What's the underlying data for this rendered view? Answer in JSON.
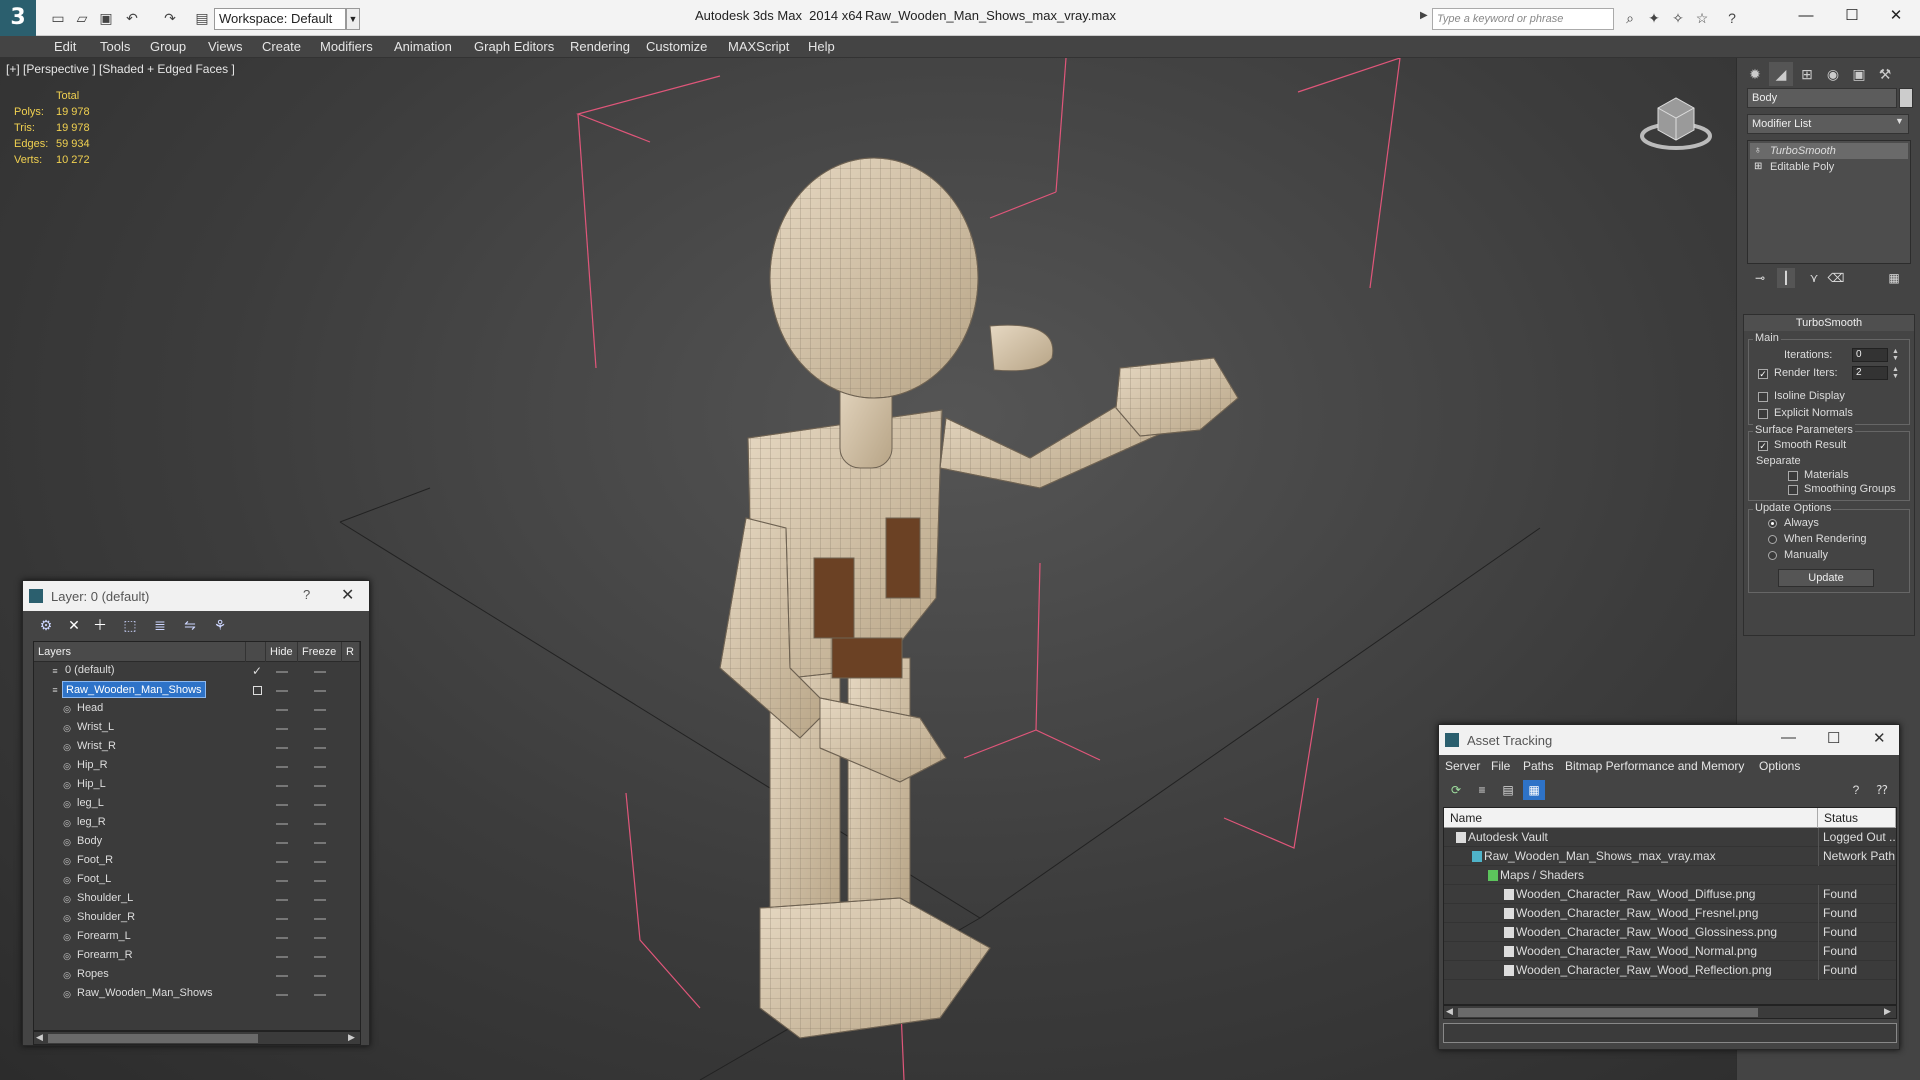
{
  "titlebar": {
    "workspace": "Workspace: Default",
    "app_title": "Autodesk 3ds Max  2014 x64",
    "file_title": "Raw_Wooden_Man_Shows_max_vray.max",
    "search_placeholder": "Type a keyword or phrase"
  },
  "menubar": [
    "Edit",
    "Tools",
    "Group",
    "Views",
    "Create",
    "Modifiers",
    "Animation",
    "Graph Editors",
    "Rendering",
    "Customize",
    "MAXScript",
    "Help"
  ],
  "viewport": {
    "label": "[+] [Perspective ] [Shaded + Edged Faces ]",
    "stats_header": "Total",
    "stats": [
      {
        "label": "Polys:",
        "value": "19 978"
      },
      {
        "label": "Tris:",
        "value": "19 978"
      },
      {
        "label": "Edges:",
        "value": "59 934"
      },
      {
        "label": "Verts:",
        "value": "10 272"
      }
    ]
  },
  "command_panel": {
    "object_name": "Body",
    "modifier_list": "Modifier List",
    "stack": [
      "TurboSmooth",
      "Editable Poly"
    ],
    "rollout_title": "TurboSmooth",
    "main_group": "Main",
    "iterations_label": "Iterations:",
    "iterations_value": "0",
    "render_iters_label": "Render Iters:",
    "render_iters_value": "2",
    "isoline_label": "Isoline Display",
    "explicit_normals_label": "Explicit Normals",
    "surface_group": "Surface Parameters",
    "smooth_result_label": "Smooth Result",
    "separate_label": "Separate",
    "materials_label": "Materials",
    "smoothing_groups_label": "Smoothing Groups",
    "update_group": "Update Options",
    "always_label": "Always",
    "when_rendering_label": "When Rendering",
    "manually_label": "Manually",
    "update_button": "Update"
  },
  "layer_dialog": {
    "title": "Layer: 0 (default)",
    "help": "?",
    "columns": {
      "layers": "Layers",
      "hide": "Hide",
      "freeze": "Freeze",
      "render": "R"
    },
    "rows": [
      {
        "name": "0 (default)",
        "indent": 1
      },
      {
        "name": "Raw_Wooden_Man_Shows",
        "indent": 1
      },
      {
        "name": "Head",
        "indent": 2
      },
      {
        "name": "Wrist_L",
        "indent": 2
      },
      {
        "name": "Wrist_R",
        "indent": 2
      },
      {
        "name": "Hip_R",
        "indent": 2
      },
      {
        "name": "Hip_L",
        "indent": 2
      },
      {
        "name": "leg_L",
        "indent": 2
      },
      {
        "name": "leg_R",
        "indent": 2
      },
      {
        "name": "Body",
        "indent": 2
      },
      {
        "name": "Foot_R",
        "indent": 2
      },
      {
        "name": "Foot_L",
        "indent": 2
      },
      {
        "name": "Shoulder_L",
        "indent": 2
      },
      {
        "name": "Shoulder_R",
        "indent": 2
      },
      {
        "name": "Forearm_L",
        "indent": 2
      },
      {
        "name": "Forearm_R",
        "indent": 2
      },
      {
        "name": "Ropes",
        "indent": 2
      },
      {
        "name": "Raw_Wooden_Man_Shows",
        "indent": 2
      }
    ]
  },
  "asset_dialog": {
    "title": "Asset Tracking",
    "menu": [
      "Server",
      "File",
      "Paths",
      "Bitmap Performance and Memory",
      "Options"
    ],
    "columns": {
      "name": "Name",
      "status": "Status"
    },
    "rows": [
      {
        "name": "Autodesk Vault",
        "status": "Logged Out ..."
      },
      {
        "name": "Raw_Wooden_Man_Shows_max_vray.max",
        "status": "Network Path"
      },
      {
        "name": "Maps / Shaders",
        "status": ""
      },
      {
        "name": "Wooden_Character_Raw_Wood_Diffuse.png",
        "status": "Found"
      },
      {
        "name": "Wooden_Character_Raw_Wood_Fresnel.png",
        "status": "Found"
      },
      {
        "name": "Wooden_Character_Raw_Wood_Glossiness.png",
        "status": "Found"
      },
      {
        "name": "Wooden_Character_Raw_Wood_Normal.png",
        "status": "Found"
      },
      {
        "name": "Wooden_Character_Raw_Wood_Reflection.png",
        "status": "Found"
      }
    ]
  },
  "colors": {
    "selection": "#2e73c8",
    "stats_text": "#f0d050",
    "bounding_box": "#e0567a",
    "wood": "#d9c9b0"
  }
}
